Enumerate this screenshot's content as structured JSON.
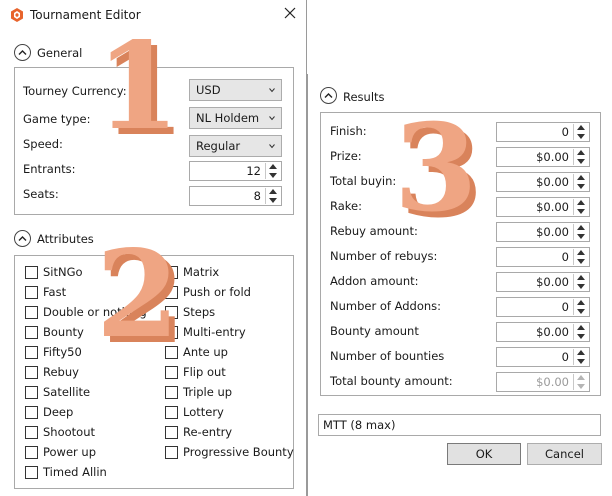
{
  "editor": {
    "title": "Tournament Editor",
    "general": {
      "title": "General",
      "currency_label": "Tourney Currency:",
      "currency_value": "USD",
      "game_type_label": "Game type:",
      "game_type_value": "NL Holdem",
      "speed_label": "Speed:",
      "speed_value": "Regular",
      "entrants_label": "Entrants:",
      "entrants_value": "12",
      "seats_label": "Seats:",
      "seats_value": "8"
    },
    "attributes": {
      "title": "Attributes",
      "col1": [
        "SitNGo",
        "Fast",
        "Double or nothing",
        "Bounty",
        "Fifty50",
        "Rebuy",
        "Satellite",
        "Deep",
        "Shootout",
        "Power up",
        "Timed Allin"
      ],
      "col2": [
        "Matrix",
        "Push or fold",
        "Steps",
        "Multi-entry",
        "Ante up",
        "Flip out",
        "Triple up",
        "Lottery",
        "Re-entry",
        "Progressive Bounty"
      ]
    },
    "overlay_numbers": {
      "n1": "1",
      "n2": "2",
      "n3": "3"
    }
  },
  "results": {
    "title": "Results",
    "rows": [
      {
        "label": "Finish:",
        "value": "0",
        "disabled": false
      },
      {
        "label": "Prize:",
        "value": "$0.00",
        "disabled": false
      },
      {
        "label": "Total buyin:",
        "value": "$0.00",
        "disabled": false
      },
      {
        "label": "Rake:",
        "value": "$0.00",
        "disabled": false
      },
      {
        "label": "Rebuy amount:",
        "value": "$0.00",
        "disabled": false
      },
      {
        "label": "Number of rebuys:",
        "value": "0",
        "disabled": false
      },
      {
        "label": "Addon amount:",
        "value": "$0.00",
        "disabled": false
      },
      {
        "label": "Number of Addons:",
        "value": "0",
        "disabled": false
      },
      {
        "label": "Bounty amount",
        "value": "$0.00",
        "disabled": false
      },
      {
        "label": "Number of bounties",
        "value": "0",
        "disabled": false
      },
      {
        "label": "Total bounty amount:",
        "value": "$0.00",
        "disabled": true
      }
    ],
    "summary": "MTT (8 max)",
    "ok_label": "OK",
    "cancel_label": "Cancel"
  },
  "colors": {
    "overlay_face": "#efa583",
    "overlay_side": "#d9835b",
    "app_icon": "#e8642c"
  }
}
